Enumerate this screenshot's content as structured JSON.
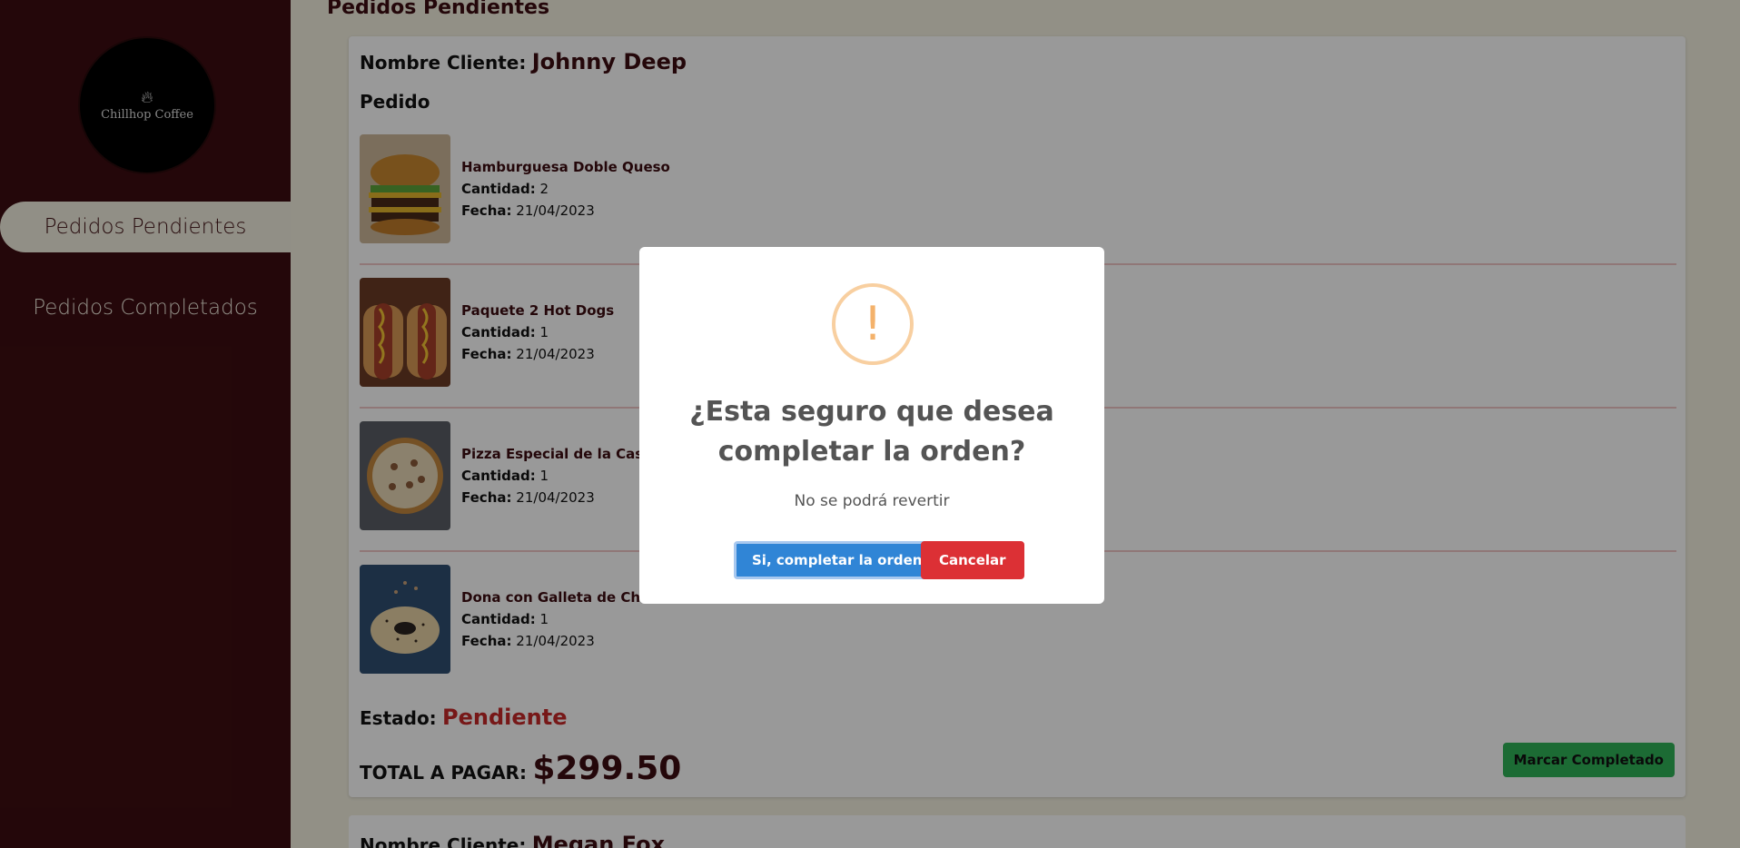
{
  "sidebar": {
    "logo_text": "Chillhop Coffee",
    "items": [
      {
        "label": "Pedidos Pendientes"
      },
      {
        "label": "Pedidos Completados"
      }
    ]
  },
  "main": {
    "section_title": "Pedidos Pendientes",
    "orders": [
      {
        "client_label": "Nombre Cliente:",
        "client_name": "Johnny Deep",
        "pedido_label": "Pedido",
        "items": [
          {
            "name": "Hamburguesa Doble Queso",
            "qty_label": "Cantidad:",
            "qty": "2",
            "date_label": "Fecha:",
            "date": "21/04/2023"
          },
          {
            "name": "Paquete 2 Hot Dogs",
            "qty_label": "Cantidad:",
            "qty": "1",
            "date_label": "Fecha:",
            "date": "21/04/2023"
          },
          {
            "name": "Pizza Especial de la Casa",
            "qty_label": "Cantidad:",
            "qty": "1",
            "date_label": "Fecha:",
            "date": "21/04/2023"
          },
          {
            "name": "Dona con Galleta de Choco",
            "qty_label": "Cantidad:",
            "qty": "1",
            "date_label": "Fecha:",
            "date": "21/04/2023"
          }
        ],
        "estado_label": "Estado:",
        "estado": "Pendiente",
        "total_label": "TOTAL A PAGAR:",
        "total": "$299.50",
        "complete_button": "Marcar Completado"
      },
      {
        "client_label": "Nombre Cliente:",
        "client_name": "Megan Fox"
      }
    ]
  },
  "modal": {
    "icon": "!",
    "title": "¿Esta seguro que desea completar la orden?",
    "text": "No se podrá revertir",
    "confirm_label": "Si, completar la orden",
    "cancel_label": "Cancelar"
  },
  "colors": {
    "sidebar_bg": "#3d0d11",
    "main_bg": "#f3f0e0",
    "accent": "#3d0d11",
    "status_pending": "#c62828",
    "confirm": "#3085d6",
    "cancel": "#dc3035",
    "complete": "#2fb257"
  }
}
